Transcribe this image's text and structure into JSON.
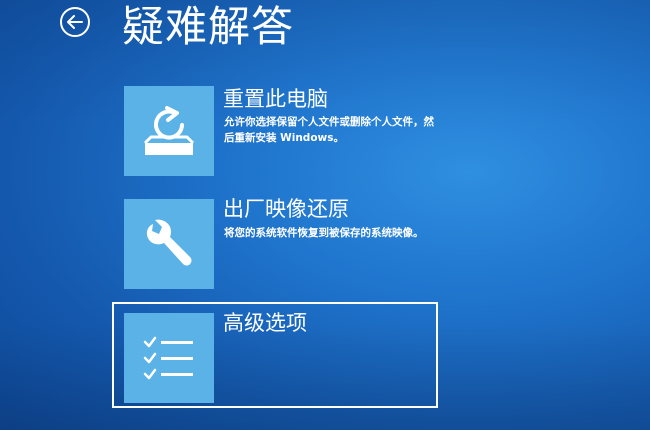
{
  "header": {
    "title": "疑难解答",
    "back_icon": "back-arrow-icon"
  },
  "options": [
    {
      "title": "重置此电脑",
      "description": "允许你选择保留个人文件或删除个人文件，然后重新安装 Windows。",
      "icon": "reset-pc-icon"
    },
    {
      "title": "出厂映像还原",
      "description": "将您的系统软件恢复到被保存的系统映像。",
      "icon": "wrench-icon"
    },
    {
      "title": "高级选项",
      "description": "",
      "icon": "checklist-icon",
      "focused": true
    }
  ],
  "colors": {
    "background": "#1f74cc",
    "tile": "#5ab2e6",
    "text": "#ffffff"
  }
}
